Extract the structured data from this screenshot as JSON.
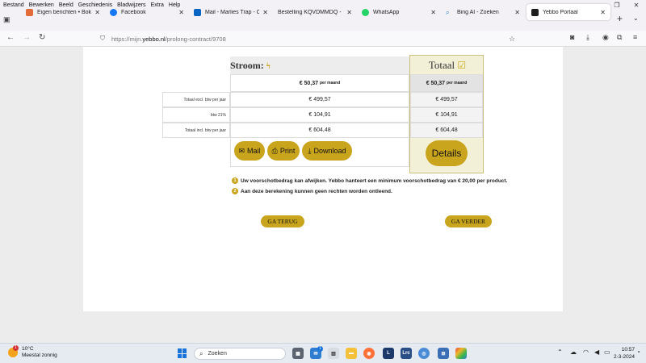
{
  "menu": [
    "Bestand",
    "Bewerken",
    "Beeld",
    "Geschiedenis",
    "Bladwijzers",
    "Extra",
    "Help"
  ],
  "tabs": [
    {
      "label": "Eigen berichten • Bokt.nl",
      "color": "#e36b3a"
    },
    {
      "label": "Facebook",
      "color": "#1877f2"
    },
    {
      "label": "Mail - Marlies Trap - Outlo",
      "color": "#0a64c4"
    },
    {
      "label": "Bestelling KQVDMMDQ - Marl",
      "color": "#888888"
    },
    {
      "label": "WhatsApp",
      "color": "#25d366"
    },
    {
      "label": "Bing AI - Zoeken",
      "color": "#2a7bd4"
    },
    {
      "label": "Yebbo Portaal",
      "color": "#1c1c1c"
    }
  ],
  "url": {
    "prefix": "https://mijn.",
    "domain": "yebbo.nl",
    "path": "/prolong-contract/9708"
  },
  "table": {
    "stroom_title": "Stroom:",
    "totaal_title": "Totaal",
    "monthly_value": "€ 50,37",
    "monthly_unit": "per maand",
    "rows": [
      {
        "label": "Totaal excl. btw",
        "unit": "per jaar",
        "stroom": "€ 499,57",
        "totaal": "€ 499,57"
      },
      {
        "label": "btw 21%",
        "unit": "",
        "stroom": "€ 104,91",
        "totaal": "€ 104,91"
      },
      {
        "label": "Totaal incl. btw",
        "unit": "per jaar",
        "stroom": "€ 604,48",
        "totaal": "€ 604,48"
      }
    ]
  },
  "buttons": {
    "mail": "Mail",
    "print": "Print",
    "download": "Download",
    "details": "Details",
    "back": "GA TERUG",
    "next": "GA VERDER"
  },
  "notes": [
    {
      "num": "1",
      "text": "Uw voorschotbedrag kan afwijken. Yebbo hanteert een minimum voorschotbedrag van € 20,00 per product."
    },
    {
      "num": "2",
      "text": "Aan deze berekening kunnen geen rechten worden ontleend."
    }
  ],
  "taskbar": {
    "weather_temp": "10°C",
    "weather_desc": "Meestal zonnig",
    "weather_badge": "1",
    "search_placeholder": "Zoeken",
    "time": "10:57",
    "date": "2-3-2024",
    "mail_badge": "1"
  },
  "colors": {
    "gold": "#c9a41d"
  }
}
